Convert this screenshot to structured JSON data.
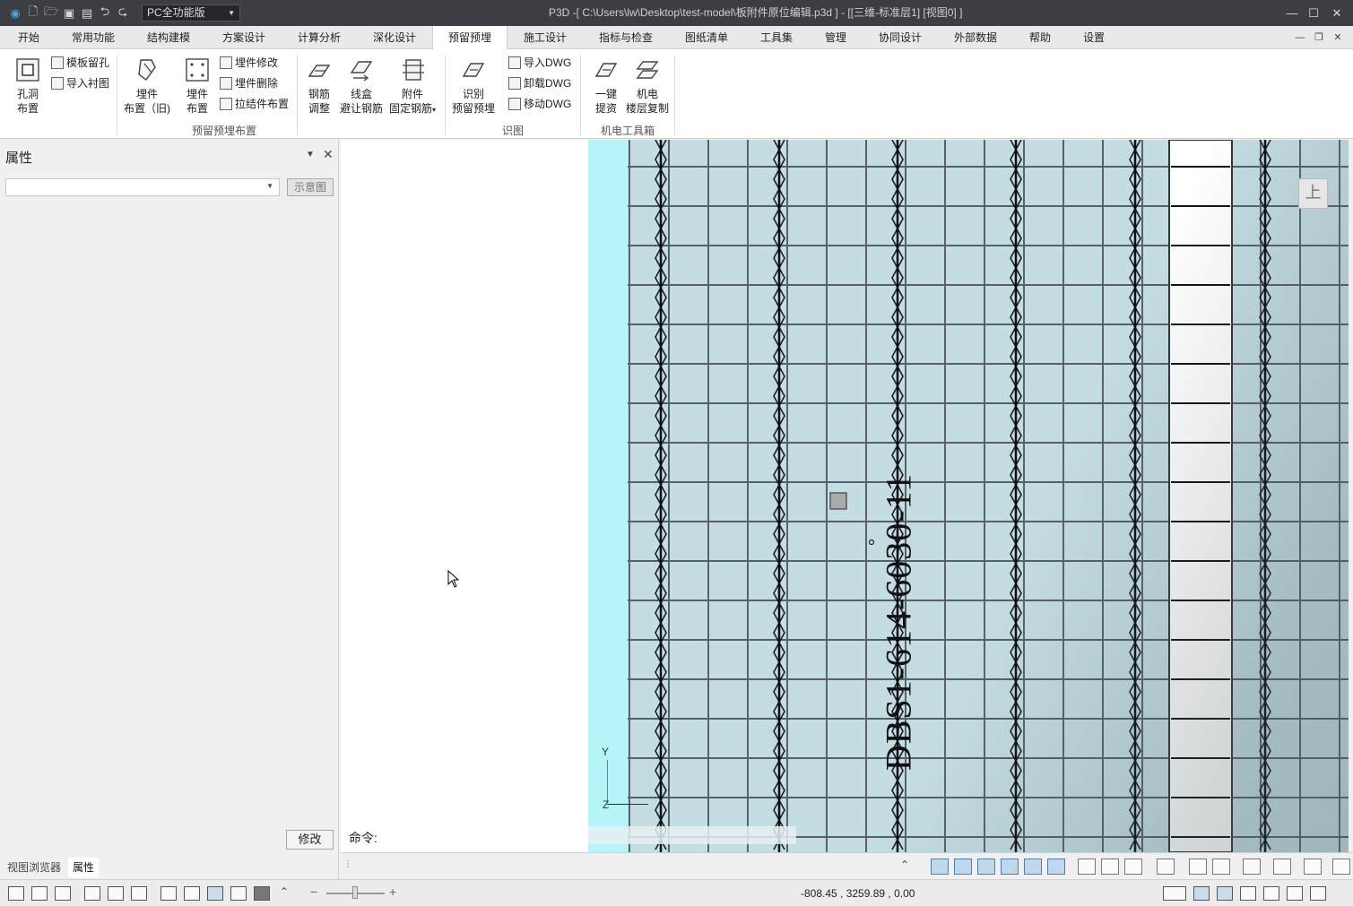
{
  "titlebar": {
    "edition": "PC全功能版",
    "title": "P3D -[ C:\\Users\\lw\\Desktop\\test-model\\板附件原位编辑.p3d ] - [[三维-标准层1]  [视图0] ]",
    "app_color": "#3b3f44"
  },
  "menu": {
    "tabs": [
      "开始",
      "常用功能",
      "结构建模",
      "方案设计",
      "计算分析",
      "深化设计",
      "预留预埋",
      "施工设计",
      "指标与检查",
      "图纸清单",
      "工具集",
      "管理",
      "协同设计",
      "外部数据",
      "帮助",
      "设置"
    ],
    "active": "预留预埋"
  },
  "ribbon": {
    "hole_layout": [
      "孔洞",
      "布置"
    ],
    "template_hole": "模板留孔",
    "import_underlay": "导入衬图",
    "embed_old": [
      "埋件",
      "布置（旧)"
    ],
    "embed": [
      "埋件",
      "布置"
    ],
    "embed_modify": "埋件修改",
    "embed_delete": "埋件删除",
    "tie_layout": "拉结件布置",
    "rebar_adjust": [
      "钢筋",
      "调整"
    ],
    "box_avoid": [
      "线盒",
      "避让钢筋"
    ],
    "attach_fix": [
      "附件",
      "固定钢筋"
    ],
    "recognize": [
      "识别",
      "预留预埋"
    ],
    "import_dwg": "导入DWG",
    "unload_dwg": "卸载DWG",
    "move_dwg": "移动DWG",
    "one_click": [
      "一键",
      "提资"
    ],
    "mep_copy": [
      "机电",
      "楼层复制"
    ],
    "groups": [
      "预留预埋布置",
      "识图",
      "机电工具箱"
    ]
  },
  "panel": {
    "title": "属性",
    "diagram_btn": "示意图",
    "modify_btn": "修改",
    "tabs": [
      "视图浏览器",
      "属性"
    ],
    "active_tab": "属性"
  },
  "view": {
    "command_label": "命令:",
    "up_label": "上",
    "rebar_text": "DBS1-614-6030-11",
    "axis_y": "Y",
    "axis_z": "Z",
    "colors": {
      "slab": "#c4dde2",
      "edge": "#b7f4f9"
    }
  },
  "status": {
    "coords": "-808.45 , 3259.89 , 0.00"
  }
}
